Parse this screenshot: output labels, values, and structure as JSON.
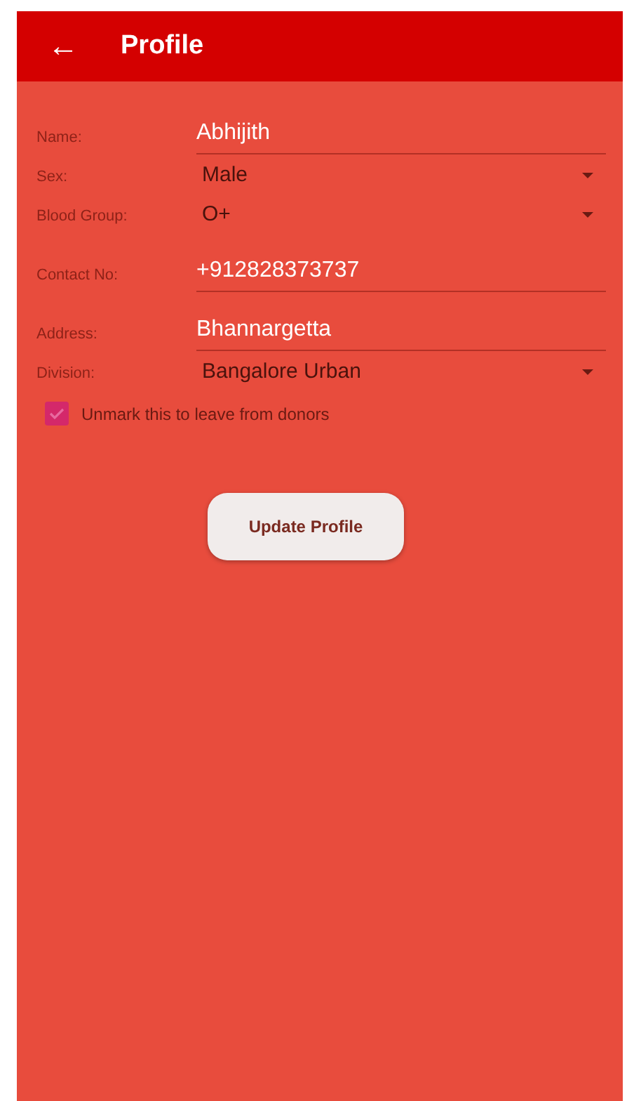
{
  "app_bar": {
    "back": "←",
    "title": "Profile"
  },
  "fields": [
    {
      "kind": "text",
      "label": "Name:",
      "value": "Abhijith"
    },
    {
      "kind": "dropdown",
      "label": "Sex:",
      "value": "Male"
    },
    {
      "kind": "dropdown",
      "label": "Blood Group:",
      "value": "O+"
    },
    {
      "kind": "text",
      "label": "Contact No:",
      "value": "+912828373737"
    },
    {
      "kind": "text",
      "label": "Address:",
      "value": "Bhannargetta"
    },
    {
      "kind": "dropdown",
      "label": "Division:",
      "value": "Bangalore Urban"
    }
  ],
  "donor_checkbox": {
    "label": "Unmark this to leave from donors",
    "checked": true
  },
  "update_button": "Update Profile"
}
